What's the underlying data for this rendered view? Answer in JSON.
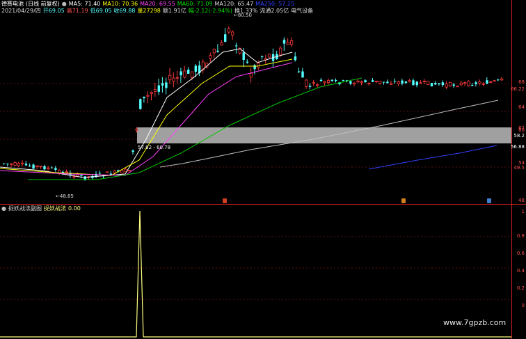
{
  "header": {
    "stock_name": "德赛电池",
    "period": "(日线 前复权)",
    "ma5_label": "MA5: 71.40",
    "ma10_label": "MA10: 70.36",
    "ma20_label": "MA20: 69.55",
    "ma60_label": "MA60: 71.09",
    "ma120_label": "MA120: 65.47",
    "ma250_label": "MA250: 57.25"
  },
  "info_bar": {
    "date": "2021/04/29/四",
    "open": "开69.05",
    "high": "高71.19",
    "low": "低69.05",
    "close": "收69.88",
    "volume": "量27298",
    "amount": "额1.91亿",
    "change": "幅-2.12(-2.94%)",
    "turnover": "换1.33%",
    "float": "流通2.05亿",
    "sector": "电气设备"
  },
  "annotations": {
    "peak_price": "80.50",
    "low_price": "48.85",
    "range_label": "57.82 - 60.78"
  },
  "price_axis": [
    "68",
    "66.22",
    "64",
    "62",
    "60",
    "58.2",
    "56.88",
    "54",
    "49.5",
    "48"
  ],
  "sub_panel": {
    "indicator_name": "捉妖战法副图",
    "series_name": "捉妖战法",
    "series_value": "0.00",
    "axis": [
      "1",
      "0.8",
      "0.6",
      "0.4",
      "0.2",
      "0"
    ]
  },
  "colors": {
    "up": "#ff3a3a",
    "down": "#54ffff",
    "ma5": "#ffffff",
    "ma10": "#ffff00",
    "ma20": "#ff40ff",
    "ma60": "#00c800",
    "ma120": "#c0c0c0",
    "ma250": "#3040ff",
    "band": "#bcbcbc",
    "signal": "#ffff80",
    "divider": "#c81e1e"
  },
  "watermark": "www.7gpzb.com"
}
